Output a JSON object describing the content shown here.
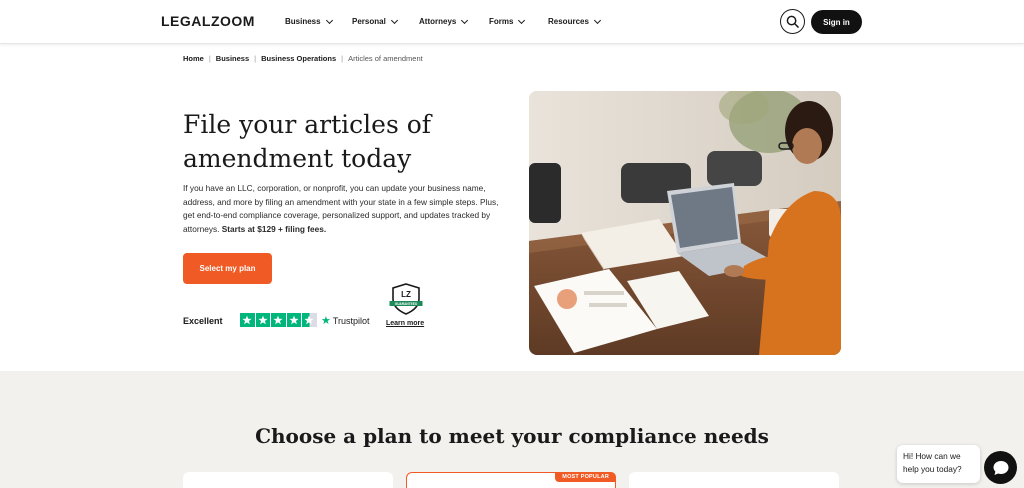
{
  "header": {
    "logo": "LEGALZOOM",
    "nav": [
      {
        "label": "Business"
      },
      {
        "label": "Personal"
      },
      {
        "label": "Attorneys"
      },
      {
        "label": "Forms"
      },
      {
        "label": "Resources"
      }
    ],
    "search_icon": "search-icon",
    "signin_label": "Sign in"
  },
  "breadcrumb": {
    "items": [
      "Home",
      "Business",
      "Business Operations"
    ],
    "current": "Articles of amendment",
    "separator": "|"
  },
  "hero": {
    "title_line1": "File your articles of",
    "title_line2": "amendment today",
    "description": "If you have an LLC, corporation, or nonprofit, you can update your business name, address, and more by filing an amendment with your state in a few simple steps. Plus, get end-to-end compliance coverage, personalized support, and updates tracked by attorneys.",
    "price_note": "Starts at $129 + filing fees.",
    "cta_label": "Select my plan",
    "rating_label": "Excellent",
    "rating_stars": 4.5,
    "trustpilot_label": "Trustpilot",
    "learn_more_label": "Learn more",
    "guarantee_badge_text": "GUARANTEED"
  },
  "plans_section": {
    "title": "Choose a plan to meet your compliance needs",
    "popular_badge": "MOST POPULAR"
  },
  "chat": {
    "greeting_line1": "Hi! How can we",
    "greeting_line2": "help you today?"
  },
  "colors": {
    "accent": "#f05a24",
    "trustpilot_green": "#00b67a",
    "dark": "#111111",
    "band_bg": "#f2f1ee"
  }
}
